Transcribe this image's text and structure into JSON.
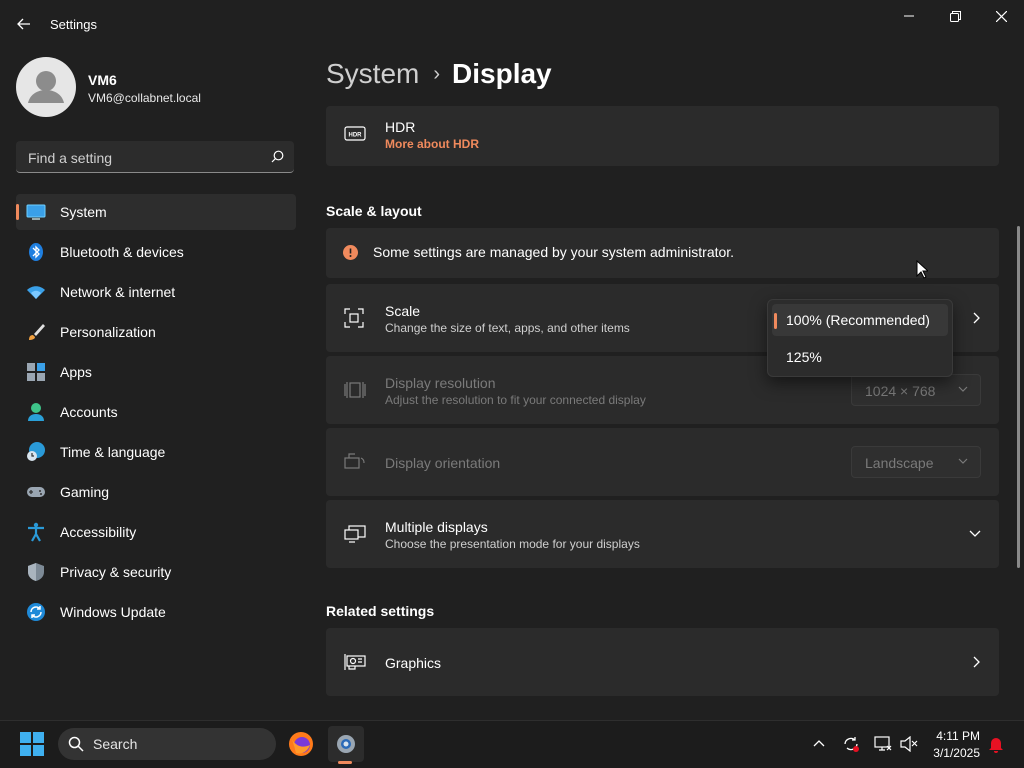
{
  "window": {
    "title": "Settings"
  },
  "user": {
    "name": "VM6",
    "email": "VM6@collabnet.local"
  },
  "search": {
    "placeholder": "Find a setting"
  },
  "nav": {
    "items": [
      {
        "label": "System",
        "icon": "monitor-icon",
        "selected": true
      },
      {
        "label": "Bluetooth & devices",
        "icon": "bluetooth-icon"
      },
      {
        "label": "Network & internet",
        "icon": "wifi-icon"
      },
      {
        "label": "Personalization",
        "icon": "brush-icon"
      },
      {
        "label": "Apps",
        "icon": "apps-icon"
      },
      {
        "label": "Accounts",
        "icon": "person-icon"
      },
      {
        "label": "Time & language",
        "icon": "globe-clock-icon"
      },
      {
        "label": "Gaming",
        "icon": "gamepad-icon"
      },
      {
        "label": "Accessibility",
        "icon": "accessibility-icon"
      },
      {
        "label": "Privacy & security",
        "icon": "shield-icon"
      },
      {
        "label": "Windows Update",
        "icon": "update-icon"
      }
    ]
  },
  "breadcrumb": {
    "parent": "System",
    "separator": "›",
    "current": "Display"
  },
  "hdr": {
    "title": "HDR",
    "link": "More about HDR"
  },
  "scale_layout": {
    "heading": "Scale & layout",
    "admin_notice": "Some settings are managed by your system administrator.",
    "scale": {
      "title": "Scale",
      "subtitle": "Change the size of text, apps, and other items"
    },
    "resolution": {
      "title": "Display resolution",
      "subtitle": "Adjust the resolution to fit your connected display",
      "value": "1024 × 768"
    },
    "orientation": {
      "title": "Display orientation",
      "value": "Landscape"
    },
    "multiple_displays": {
      "title": "Multiple displays",
      "subtitle": "Choose the presentation mode for your displays"
    }
  },
  "scale_dropdown": {
    "options": [
      "100% (Recommended)",
      "125%"
    ],
    "selected": "100% (Recommended)"
  },
  "related": {
    "heading": "Related settings",
    "graphics": {
      "title": "Graphics"
    }
  },
  "taskbar": {
    "search_label": "Search",
    "time": "4:11 PM",
    "date": "3/1/2025"
  },
  "colors": {
    "accent": "#f08a5d",
    "background": "#202020",
    "card": "#2b2b2b"
  }
}
